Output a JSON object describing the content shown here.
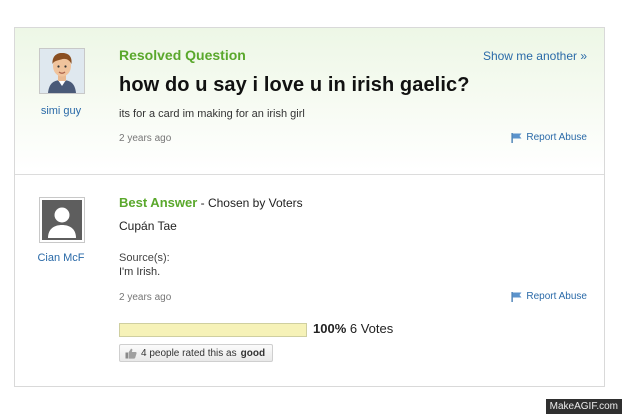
{
  "question": {
    "status_label": "Resolved Question",
    "show_another": "Show me another »",
    "title": "how do u say i love u in irish gaelic?",
    "detail": "its for a card im making for an irish girl",
    "time_ago": "2 years ago",
    "report_label": "Report Abuse",
    "asker": "simi guy"
  },
  "answer": {
    "best_label": "Best Answer",
    "chosen_by": " - Chosen by Voters",
    "text": "Cupán Tae",
    "source_label": "Source(s):",
    "source_value": "I'm Irish.",
    "time_ago": "2 years ago",
    "report_label": "Report Abuse",
    "answerer": "Cian McF",
    "vote_percent_text": "100%",
    "vote_percent_value": 100,
    "votes_text": "6 Votes",
    "rated_prefix": "4 people rated this as",
    "rated_value": "good"
  },
  "watermark": "MakeAGIF.com",
  "colors": {
    "accent_green": "#5aa82c",
    "link_blue": "#2a6aa8",
    "vote_bar_fill": "#f6f2b8"
  },
  "icons": [
    "avatar-cartoon-man",
    "avatar-default-silhouette",
    "flag-icon",
    "thumbs-up-icon"
  ]
}
